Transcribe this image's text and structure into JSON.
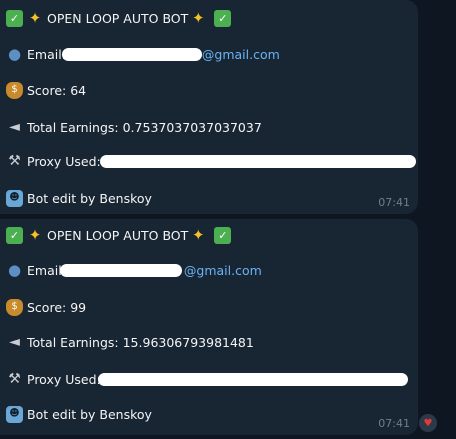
{
  "messages": [
    {
      "title": "OPEN LOOP AUTO BOT",
      "email_label": "Email:",
      "email_domain": "@gmail.com",
      "score_label": "Score:",
      "score": "64",
      "earnings_label": "Total Earnings:",
      "earnings": "0.7537037037037037",
      "proxy_label": "Proxy Used:",
      "credit": "Bot edit by Benskoy",
      "time": "07:41"
    },
    {
      "title": "OPEN LOOP AUTO BOT",
      "email_label": "Email:",
      "email_domain": "@gmail.com",
      "score_label": "Score:",
      "score": "99",
      "earnings_label": "Total Earnings:",
      "earnings": "15.96306793981481",
      "proxy_label": "Proxy Used:",
      "credit": "Bot edit by Benskoy",
      "time": "07:41"
    }
  ],
  "reaction": {
    "icon": "heart-icon",
    "color": "#e53935"
  },
  "colors": {
    "background": "#0e1621",
    "bubble": "#182533",
    "link": "#6ab3f3",
    "timestamp": "#6d7f8f"
  },
  "icons": [
    "check-mark-icon",
    "star-icon",
    "user-icon",
    "money-bag-icon",
    "megaphone-icon",
    "tools-icon",
    "robot-icon"
  ]
}
